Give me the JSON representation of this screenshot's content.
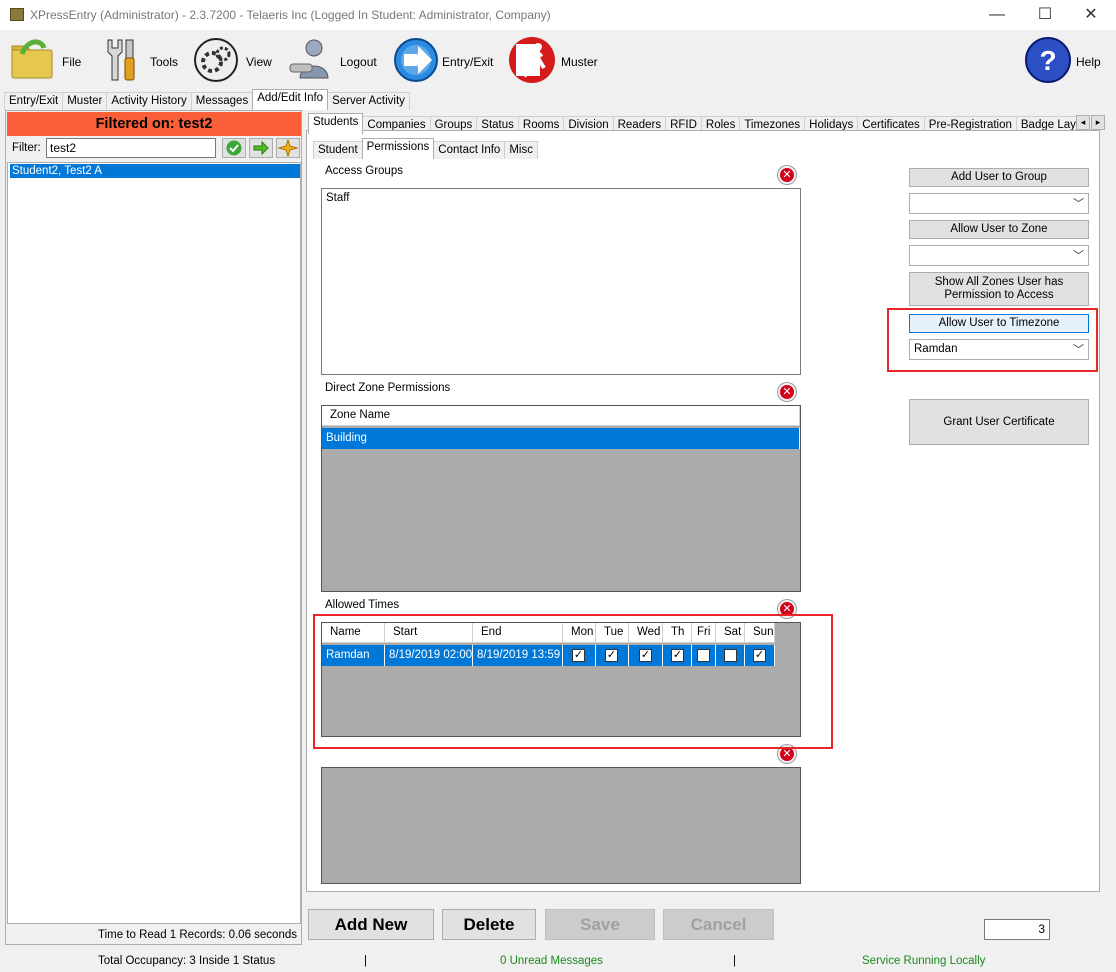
{
  "window": {
    "title": "XPressEntry (Administrator)  - 2.3.7200 - Telaeris Inc (Logged In Student: Administrator, Company)",
    "minimize": "—",
    "maximize": "☐",
    "close": "✕"
  },
  "toolbar": {
    "file": "File",
    "tools": "Tools",
    "view": "View",
    "logout": "Logout",
    "entry_exit": "Entry/Exit",
    "muster": "Muster",
    "help": "Help"
  },
  "main_tabs": [
    "Entry/Exit",
    "Muster",
    "Activity History",
    "Messages",
    "Add/Edit Info",
    "Server Activity"
  ],
  "left": {
    "filtered_on": "Filtered on: test2",
    "filter_label": "Filter:",
    "filter_value": "test2",
    "students": [
      "Student2, Test2 A"
    ],
    "read_time": "Time to Read 1 Records: 0.06 seconds"
  },
  "entity_tabs": [
    "Students",
    "Companies",
    "Groups",
    "Status",
    "Rooms",
    "Division",
    "Readers",
    "RFID",
    "Roles",
    "Timezones",
    "Holidays",
    "Certificates",
    "Pre-Registration",
    "Badge Layou"
  ],
  "scroll_left": "◂",
  "scroll_right": "▸",
  "sub_tabs": [
    "Student",
    "Permissions",
    "Contact Info",
    "Misc"
  ],
  "access_groups": {
    "label": "Access Groups",
    "items": [
      "Staff"
    ]
  },
  "direct_zone": {
    "label": "Direct Zone Permissions",
    "header": "Zone Name",
    "rows": [
      "Building"
    ]
  },
  "allowed_times": {
    "label": "Allowed Times",
    "headers": [
      "Name",
      "Start",
      "End",
      "Mon",
      "Tue",
      "Wed",
      "Th",
      "Fri",
      "Sat",
      "Sun"
    ],
    "row": {
      "name": "Ramdan",
      "start": "8/19/2019 02:00",
      "end": "8/19/2019 13:59",
      "days": [
        true,
        true,
        true,
        true,
        false,
        false,
        true
      ]
    }
  },
  "actions": {
    "add_user_to_group": "Add User to Group",
    "allow_user_to_zone": "Allow User to Zone",
    "show_all_zones": "Show All Zones User has Permission to Access",
    "allow_user_to_timezone": "Allow User to Timezone",
    "timezone_value": "Ramdan",
    "grant_certificate": "Grant User Certificate",
    "group_select": "",
    "zone_select": ""
  },
  "bottom": {
    "add_new": "Add New",
    "delete": "Delete",
    "save": "Save",
    "cancel": "Cancel",
    "count": "3"
  },
  "status": {
    "occupancy": "Total Occupancy: 3 Inside 1 Status",
    "sep1": "|",
    "messages": "0 Unread Messages",
    "sep2": "|",
    "service": "Service Running Locally"
  },
  "colors": {
    "filtered_bg": "#f9603a",
    "selection": "#0078d7",
    "highlight_box": "#e8262a",
    "status_green": "#1a8a1a"
  },
  "icons": {
    "delete": "x-circle-icon",
    "confirm": "check-circle-icon",
    "next": "green-arrow-icon",
    "clear": "sparkle-clear-icon"
  }
}
